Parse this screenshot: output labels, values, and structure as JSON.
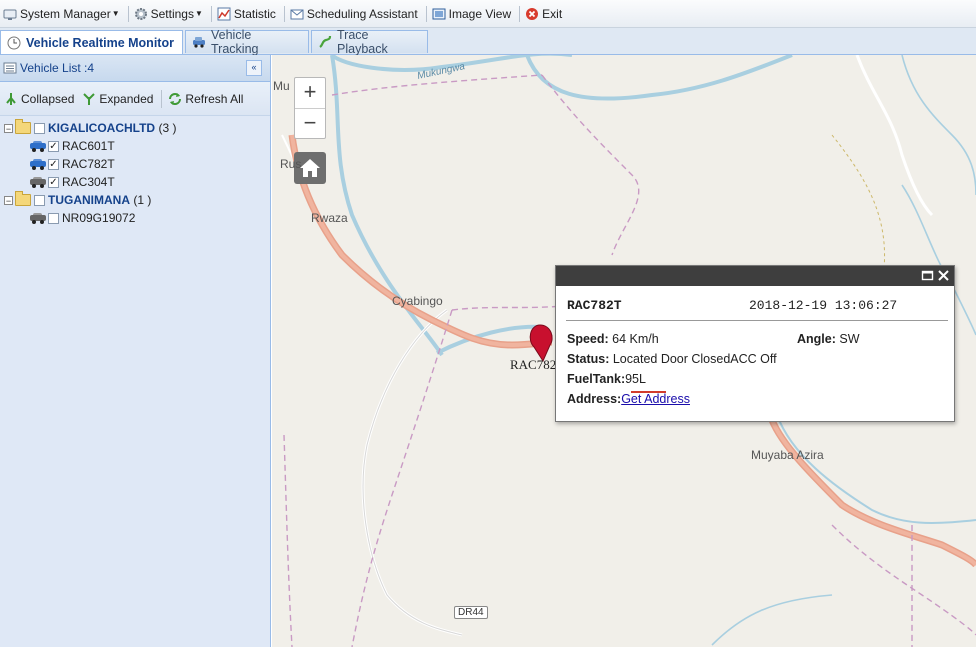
{
  "menu": [
    {
      "label": "System Manager",
      "icon": "system-manager-icon",
      "dropdown": true
    },
    {
      "label": "Settings",
      "icon": "gear-icon",
      "dropdown": true
    },
    {
      "label": "Statistic",
      "icon": "chart-icon",
      "dropdown": false
    },
    {
      "label": "Scheduling Assistant",
      "icon": "envelope-icon",
      "dropdown": false
    },
    {
      "label": "Image View",
      "icon": "image-view-icon",
      "dropdown": false
    },
    {
      "label": "Exit",
      "icon": "exit-icon",
      "dropdown": false
    }
  ],
  "tabs": [
    {
      "label": "Vehicle Realtime Monitor",
      "icon": "clock-icon",
      "active": true
    },
    {
      "label": "Vehicle Tracking",
      "icon": "car-icon",
      "active": false
    },
    {
      "label": "Trace Playback",
      "icon": "playback-icon",
      "active": false
    }
  ],
  "vehicle_list": {
    "title": "Vehicle List :4",
    "toolbar": {
      "collapsed": "Collapsed",
      "expanded": "Expanded",
      "refresh": "Refresh All"
    },
    "groups": [
      {
        "name": "KIGALICOACHLTD",
        "count": "(3 )",
        "vehicles": [
          {
            "plate": "RAC601T",
            "checked": true,
            "color": "#2e6fc9"
          },
          {
            "plate": "RAC782T",
            "checked": true,
            "color": "#2e6fc9"
          },
          {
            "plate": "RAC304T",
            "checked": true,
            "color": "#666666"
          }
        ]
      },
      {
        "name": "TUGANIMANA",
        "count": "(1 )",
        "vehicles": [
          {
            "plate": "NR09G19072",
            "checked": false,
            "color": "#666666"
          }
        ]
      }
    ]
  },
  "map": {
    "zoom_in": "+",
    "zoom_out": "−",
    "places": [
      "Mukungwa",
      "Mu",
      "Rus",
      "Rwaza",
      "Cyabingo",
      "Muyaba Azira"
    ],
    "road_badge": "DR44",
    "marker_label": "RAC782"
  },
  "popup": {
    "plate": "RAC782T",
    "time": "2018-12-19 13:06:27",
    "speed_label": "Speed:",
    "speed": "64 Km/h",
    "angle_label": "Angle:",
    "angle": "SW",
    "status_label": "Status:",
    "status": "Located Door ClosedACC Off",
    "fuel_label": "FuelTank:",
    "fuel": "95L",
    "address_label": "Address:",
    "address_link": "Get Address"
  }
}
